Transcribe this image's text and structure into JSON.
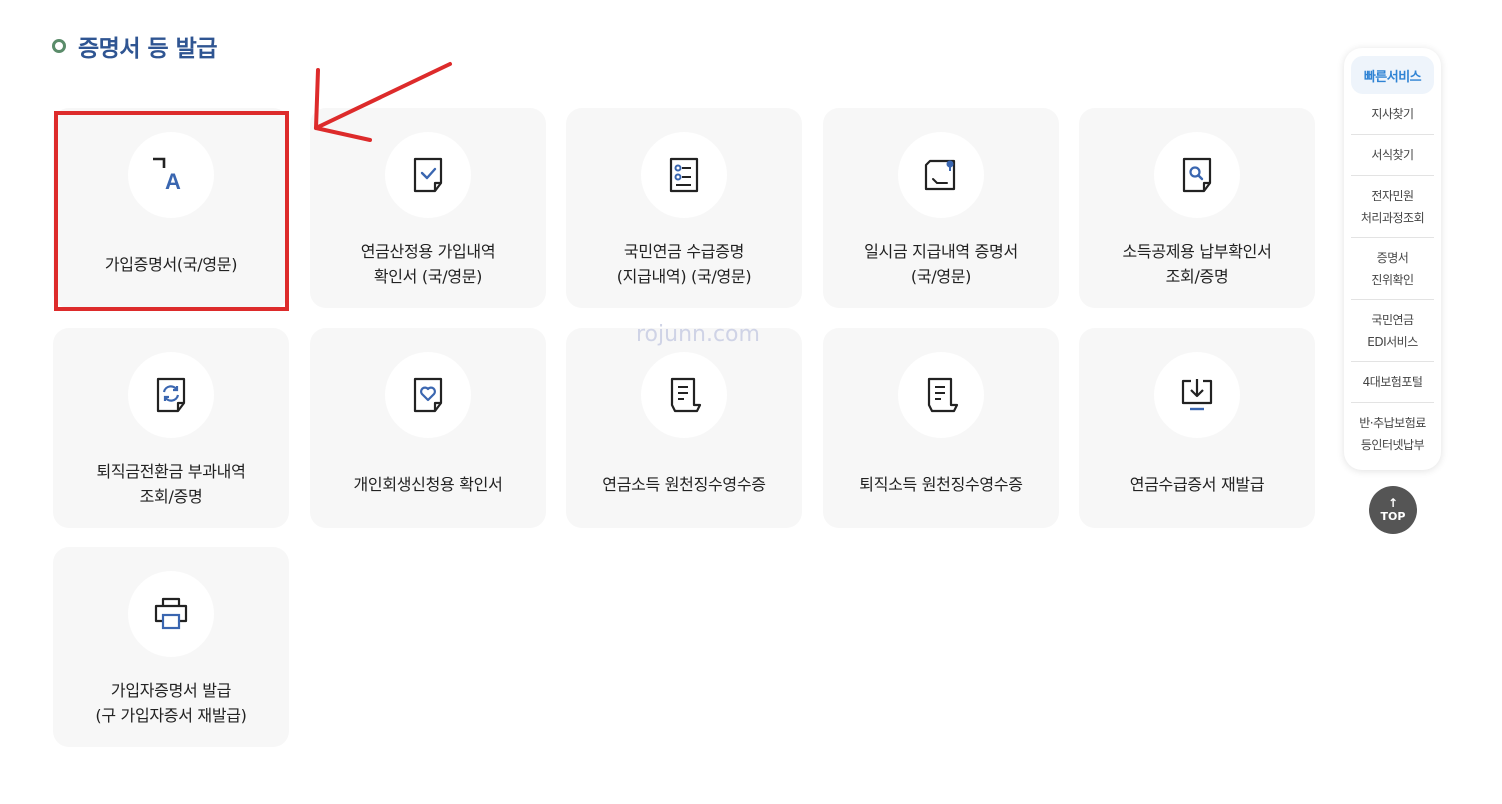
{
  "section": {
    "title": "증명서 등 발급"
  },
  "cards": [
    {
      "label": "가입증명서(국/영문)",
      "icon": "translate-icon"
    },
    {
      "label": "연금산정용 가입내역\n확인서 (국/영문)",
      "icon": "document-check-icon"
    },
    {
      "label": "국민연금 수급증명\n(지급내역) (국/영문)",
      "icon": "document-list-icon"
    },
    {
      "label": "일시금 지급내역 증명서\n(국/영문)",
      "icon": "document-pin-icon"
    },
    {
      "label": "소득공제용 납부확인서\n조회/증명",
      "icon": "document-search-icon"
    },
    {
      "label": "퇴직금전환금 부과내역\n조회/증명",
      "icon": "document-refresh-icon"
    },
    {
      "label": "개인회생신청용 확인서",
      "icon": "document-heart-icon"
    },
    {
      "label": "연금소득 원천징수영수증",
      "icon": "receipt-icon"
    },
    {
      "label": "퇴직소득 원천징수영수증",
      "icon": "receipt-icon"
    },
    {
      "label": "연금수급증서 재발급",
      "icon": "download-icon"
    },
    {
      "label": "가입자증명서 발급\n(구 가입자증서 재발급)",
      "icon": "printer-icon"
    }
  ],
  "watermark": "rojunn.com",
  "quick_service": {
    "header": "빠른서비스",
    "items": [
      "지사찾기",
      "서식찾기",
      "전자민원\n처리과정조회",
      "증명서\n진위확인",
      "국민연금\nEDI서비스",
      "4대보험포털",
      "반·추납보험료\n등인터넷납부"
    ]
  },
  "top_button": {
    "label": "TOP",
    "arrow": "↑"
  },
  "colors": {
    "title": "#2f5592",
    "icon_accent": "#3a66b0",
    "highlight": "#dd2b2b",
    "quick_header": "#2f83d4"
  }
}
